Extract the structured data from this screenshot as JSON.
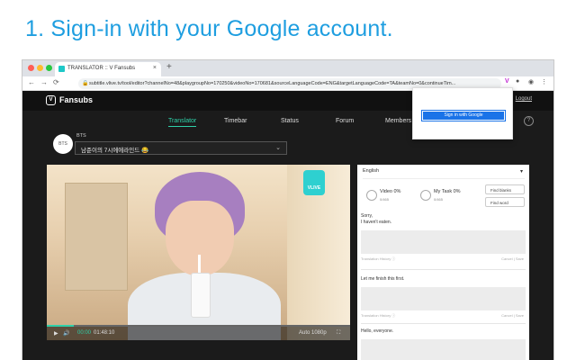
{
  "headline": "1. Sign-in with your Google account.",
  "browser": {
    "tab_title": "TRANSLATOR :: V Fansubs",
    "tab_close": "×",
    "new_tab": "+",
    "url": "subtitle.vlive.tv/tool/editor?channelNo=48&playgroupNo=170250&videoNo=170681&sourceLanguageCode=ENG&targetLanguageCode=TA&teamNo=0&continueTim...",
    "dot_colors": [
      "#ff5f57",
      "#febc2e",
      "#28c840"
    ]
  },
  "site": {
    "logo": "Fansubs",
    "logo_mark": "V",
    "logout": "Logout",
    "menu": [
      "Translator",
      "Timebar",
      "Status",
      "Forum",
      "Members"
    ],
    "help": "?",
    "channel_badge": "BTS",
    "channel_name": "BTS",
    "video_title": "남준이의 7시에에라인드 😂",
    "vlive_badge": "VLIVE",
    "video_progress": 0.09,
    "time_current": "00:00",
    "time_total": "01:48:10",
    "quality": "Auto 1080p"
  },
  "panel": {
    "language": "English",
    "video_label": "Video 0%",
    "video_sub": "0/465",
    "mytask_label": "My Task 0%",
    "mytask_sub": "0/465",
    "find_blanks": "Find blanks",
    "find_word": "Find word",
    "segments": [
      {
        "text": "Sorry,",
        "text2": "I haven't eaten.",
        "history": "Translation History ⓘ",
        "actions": "Cancel  |  Save"
      },
      {
        "text": "Let me finish this first.",
        "text2": "",
        "history": "Translation History ⓘ",
        "actions": "Cancel  |  Save"
      },
      {
        "text": "Hello, everyone.",
        "text2": "",
        "history": "Translation History ⓘ",
        "actions": "Cancel  |  Save"
      }
    ]
  },
  "popup": {
    "signin": "Sign in with Google"
  }
}
